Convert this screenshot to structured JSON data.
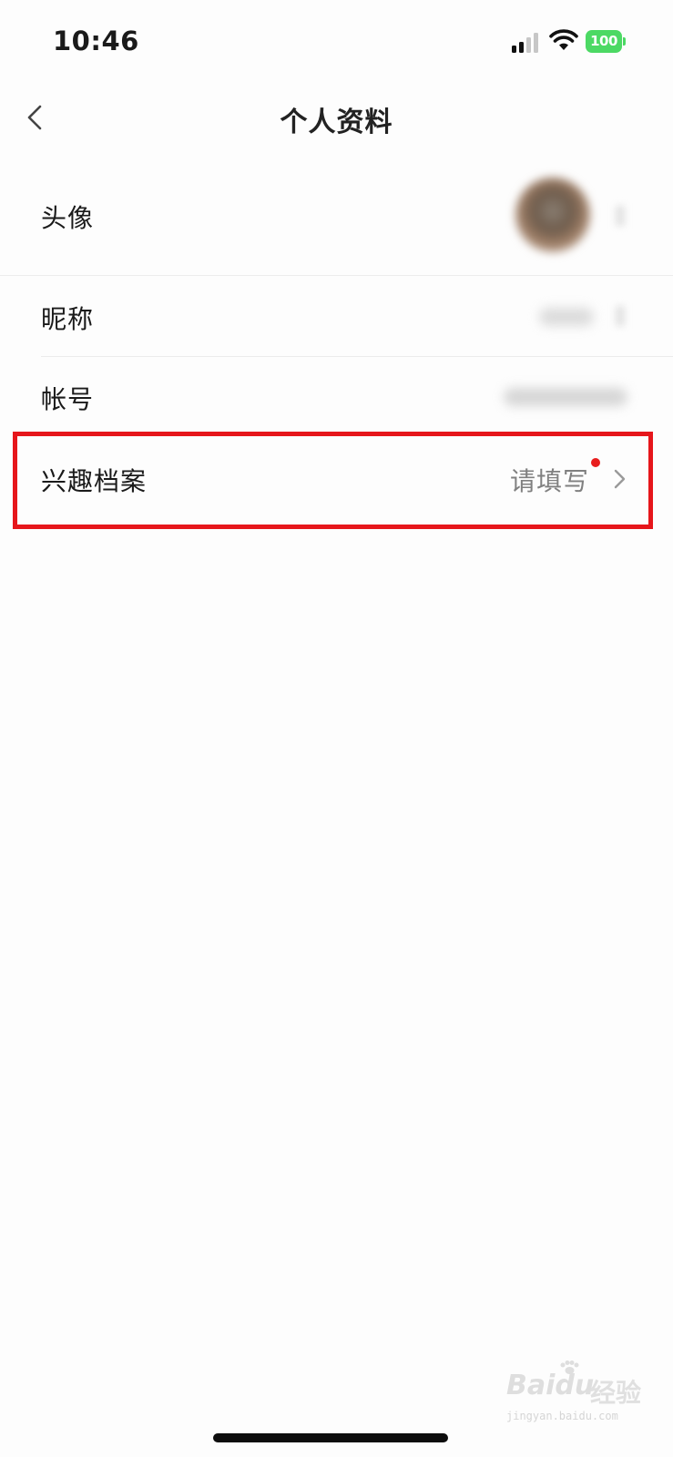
{
  "status_bar": {
    "time": "10:46",
    "battery_level": "100",
    "battery_color": "#4cd964"
  },
  "nav": {
    "title": "个人资料",
    "back_icon": "chevron-left-icon"
  },
  "rows": [
    {
      "label": "头像"
    },
    {
      "label": "昵称"
    },
    {
      "label": "帐号"
    },
    {
      "label": "兴趣档案",
      "value": "请填写",
      "badge_color": "#e81e1e"
    }
  ],
  "highlight_color": "#e6161b",
  "watermark": {
    "logo": "Baidu",
    "text": "经验",
    "url": "jingyan.baidu.com"
  }
}
